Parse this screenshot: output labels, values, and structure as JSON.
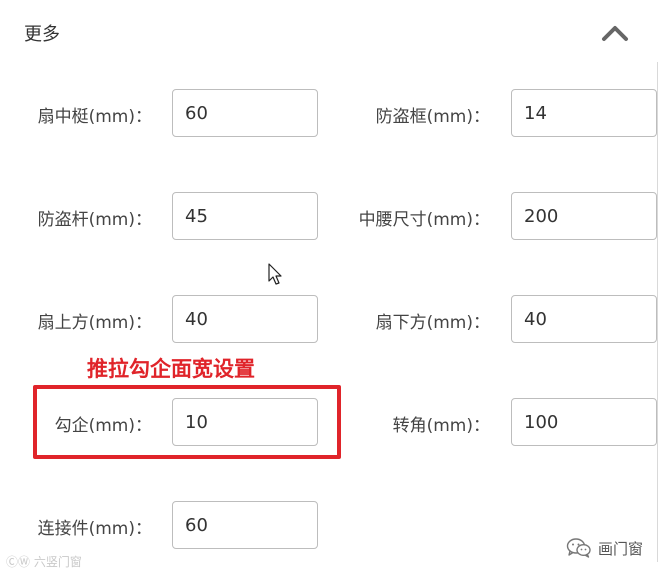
{
  "section": {
    "title": "更多",
    "collapse_icon": "chevron-up-icon"
  },
  "fields": [
    {
      "label": "扇中梃(mm)：",
      "value": "60"
    },
    {
      "label": "防盗框(mm)：",
      "value": "14"
    },
    {
      "label": "防盗杆(mm)：",
      "value": "45"
    },
    {
      "label": "中腰尺寸(mm)：",
      "value": "200"
    },
    {
      "label": "扇上方(mm)：",
      "value": "40"
    },
    {
      "label": "扇下方(mm)：",
      "value": "40"
    },
    {
      "label": "勾企(mm)：",
      "value": "10"
    },
    {
      "label": "转角(mm)：",
      "value": "100"
    },
    {
      "label": "连接件(mm)：",
      "value": "60"
    }
  ],
  "annotation": {
    "text": "推拉勾企面宽设置",
    "color": "#e0242a"
  },
  "watermarks": {
    "left": "ⒸⓌ 六竖门窗",
    "right": "画门窗",
    "right_icon": "wechat-icon"
  }
}
